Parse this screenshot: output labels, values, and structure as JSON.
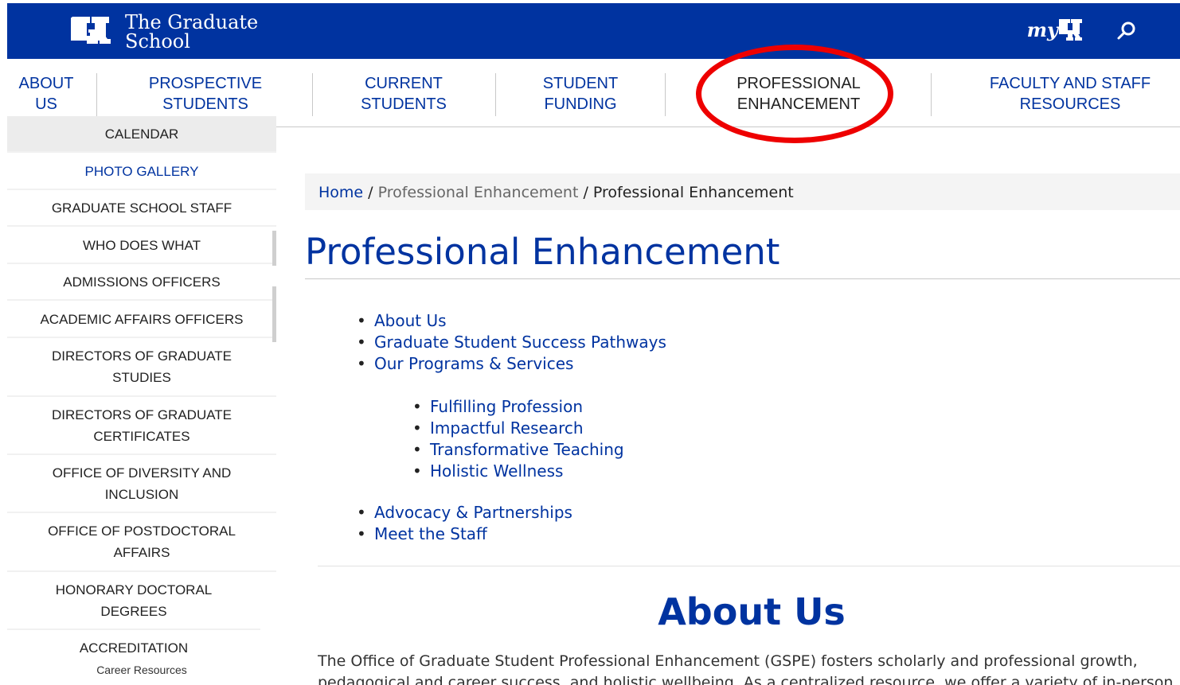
{
  "header": {
    "title_line1": "The Graduate",
    "title_line2": "School",
    "myuk_prefix": "my",
    "brand_color": "#0033a0"
  },
  "nav": {
    "items": [
      {
        "line1": "ABOUT",
        "line2": "US"
      },
      {
        "line1": "PROSPECTIVE",
        "line2": "STUDENTS"
      },
      {
        "line1": "CURRENT",
        "line2": "STUDENTS"
      },
      {
        "line1": "STUDENT",
        "line2": "FUNDING"
      },
      {
        "line1": "PROFESSIONAL",
        "line2": "ENHANCEMENT"
      },
      {
        "line1": "FACULTY AND STAFF",
        "line2": "RESOURCES"
      }
    ]
  },
  "sidebar": {
    "items": [
      {
        "label": "CALENDAR"
      },
      {
        "label": "PHOTO GALLERY"
      },
      {
        "label": "GRADUATE SCHOOL STAFF"
      },
      {
        "label": "WHO DOES WHAT"
      },
      {
        "label": "ADMISSIONS OFFICERS"
      },
      {
        "label": "ACADEMIC AFFAIRS OFFICERS"
      },
      {
        "line1": "DIRECTORS OF GRADUATE",
        "line2": "STUDIES"
      },
      {
        "line1": "DIRECTORS OF GRADUATE",
        "line2": "CERTIFICATES"
      },
      {
        "line1": "OFFICE OF DIVERSITY AND",
        "line2": "INCLUSION"
      },
      {
        "line1": "OFFICE OF POSTDOCTORAL",
        "line2": "AFFAIRS"
      },
      {
        "line1": "HONORARY DOCTORAL",
        "line2": "DEGREES"
      },
      {
        "label": "ACCREDITATION"
      }
    ],
    "partial_label": "Career Resources"
  },
  "breadcrumb": {
    "home": "Home",
    "sep": " / ",
    "middle": "Professional Enhancement",
    "current": "Professional Enhancement"
  },
  "page": {
    "title": "Professional Enhancement",
    "links": [
      "About Us",
      "Graduate Student Success Pathways",
      "Our Programs & Services"
    ],
    "sublinks": [
      "Fulfilling Profession",
      "Impactful Research",
      "Transformative Teaching",
      "Holistic Wellness"
    ],
    "links2": [
      "Advocacy & Partnerships",
      "Meet the Staff"
    ],
    "about_heading": "About Us",
    "about_line1": "The Office of Graduate Student Professional Enhancement (GSPE) fosters scholarly and professional growth,",
    "about_line2": "pedagogical and career success, and holistic wellbeing. As a centralized resource, we offer a variety of in-person"
  }
}
